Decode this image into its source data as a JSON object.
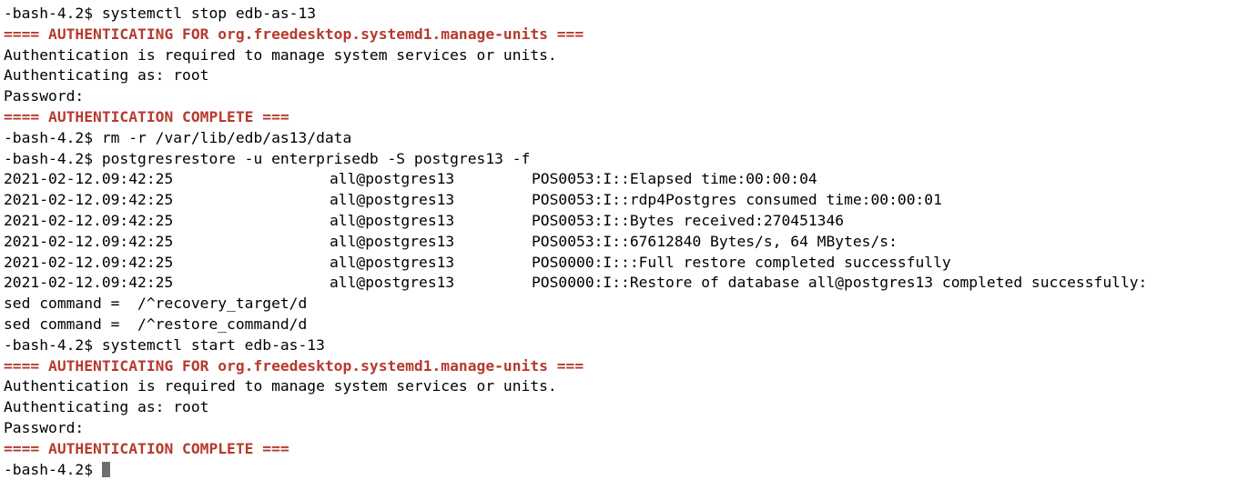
{
  "prompt": "-bash-4.2$",
  "lines": {
    "cmd_stop": "-bash-4.2$ systemctl stop edb-as-13",
    "auth_banner_1": "==== AUTHENTICATING FOR org.freedesktop.systemd1.manage-units ===",
    "auth_required_1": "Authentication is required to manage system services or units.",
    "auth_as_1": "Authenticating as: root",
    "password_1": "Password:",
    "auth_complete_1": "==== AUTHENTICATION COMPLETE ===",
    "cmd_rm": "-bash-4.2$ rm -r /var/lib/edb/as13/data",
    "cmd_restore": "-bash-4.2$ postgresrestore -u enterprisedb -S postgres13 -f",
    "sed_1": "sed command =  /^recovery_target/d",
    "sed_2": "sed command =  /^restore_command/d",
    "cmd_start": "-bash-4.2$ systemctl start edb-as-13",
    "auth_banner_2": "==== AUTHENTICATING FOR org.freedesktop.systemd1.manage-units ===",
    "auth_required_2": "Authentication is required to manage system services or units.",
    "auth_as_2": "Authenticating as: root",
    "password_2": "Password:",
    "auth_complete_2": "==== AUTHENTICATION COMPLETE ===",
    "final_prompt": "-bash-4.2$ "
  },
  "log_rows": [
    {
      "timestamp": "2021-02-12.09:42:25",
      "db": "all@postgres13",
      "message": "POS0053:I::Elapsed time:00:00:04"
    },
    {
      "timestamp": "2021-02-12.09:42:25",
      "db": "all@postgres13",
      "message": "POS0053:I::rdp4Postgres consumed time:00:00:01"
    },
    {
      "timestamp": "2021-02-12.09:42:25",
      "db": "all@postgres13",
      "message": "POS0053:I::Bytes received:270451346"
    },
    {
      "timestamp": "2021-02-12.09:42:25",
      "db": "all@postgres13",
      "message": "POS0053:I::67612840 Bytes/s, 64 MBytes/s:"
    },
    {
      "timestamp": "2021-02-12.09:42:25",
      "db": "all@postgres13",
      "message": "POS0000:I:::Full restore completed successfully"
    },
    {
      "timestamp": "2021-02-12.09:42:25",
      "db": "all@postgres13",
      "message": "POS0000:I::Restore of database all@postgres13 completed successfully:"
    }
  ],
  "colors": {
    "auth_text": "#b63a2d",
    "foreground": "#000000",
    "background": "#ffffff",
    "cursor": "#6e6e6e"
  }
}
